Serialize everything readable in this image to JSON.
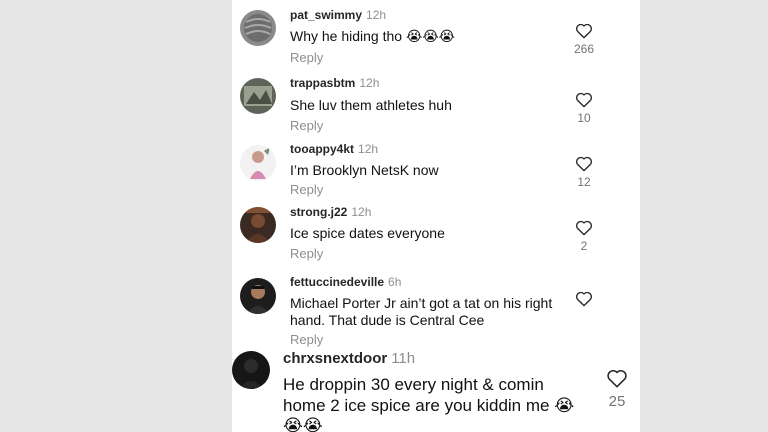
{
  "comments": [
    {
      "username": "pat_swimmy",
      "time": "12h",
      "text": "Why he hiding tho 😭😭😭",
      "reply": "Reply",
      "likes": "266",
      "avatar": "pat-avatar"
    },
    {
      "username": "trappasbtm",
      "time": "12h",
      "text": "She luv them athletes huh",
      "reply": "Reply",
      "likes": "10",
      "avatar": "trappa-avatar"
    },
    {
      "username": "tooappy4kt",
      "time": "12h",
      "text": "I’m Brooklyn NetsK now",
      "reply": "Reply",
      "likes": "12",
      "avatar": "tooappy-avatar"
    },
    {
      "username": "strong.j22",
      "time": "12h",
      "text": "Ice spice dates everyone",
      "reply": "Reply",
      "likes": "2",
      "avatar": "strong-avatar"
    },
    {
      "username": "fettuccinedeville",
      "time": "6h",
      "text": "Michael Porter Jr ain’t got a tat on his right hand. That dude is Central Cee",
      "reply": "Reply",
      "likes": "",
      "avatar": "fettuccine-avatar"
    },
    {
      "username": "chrxsnextdoor",
      "time": "11h",
      "text": "He droppin 30 every night & comin home 2 ice spice are you kiddin me 😭😭😭",
      "reply": "",
      "likes": "25",
      "avatar": "chrxs-avatar"
    }
  ],
  "colors": {
    "background": "#e6e6e6",
    "panel": "#ffffff",
    "username": "#262626",
    "muted": "#8e8e8e",
    "count": "#737373"
  },
  "icons": {
    "like": "heart-outline-icon"
  }
}
